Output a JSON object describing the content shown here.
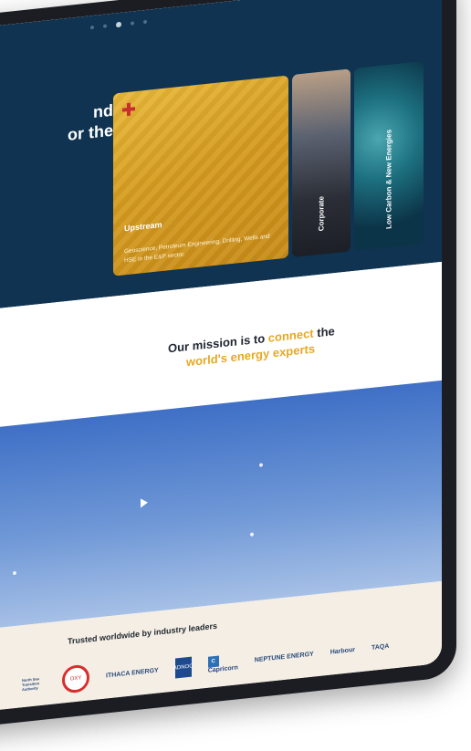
{
  "hero": {
    "title_fragment": "nd\nor the",
    "cards": [
      {
        "label": "Upstream",
        "description": "Geoscience, Petroleum Engineering, Drilling, Wells and HSE in the E&P sector."
      },
      {
        "label": "Corporate"
      },
      {
        "label": "Low Carbon & New Energies"
      }
    ]
  },
  "mission": {
    "line1_pre": "Our mission is to ",
    "line1_accent": "connect",
    "line1_post": " the",
    "line2": "world's energy experts"
  },
  "trusted": {
    "title": "Trusted worldwide by industry leaders",
    "logos": [
      "North Sea Transition Authority",
      "OXY",
      "ITHACA ENERGY",
      "ADNOC",
      "Capricorn",
      "NEPTUNE ENERGY",
      "Harbour",
      "TAQA"
    ]
  },
  "colors": {
    "navy": "#0f3350",
    "accent": "#e7a823"
  }
}
